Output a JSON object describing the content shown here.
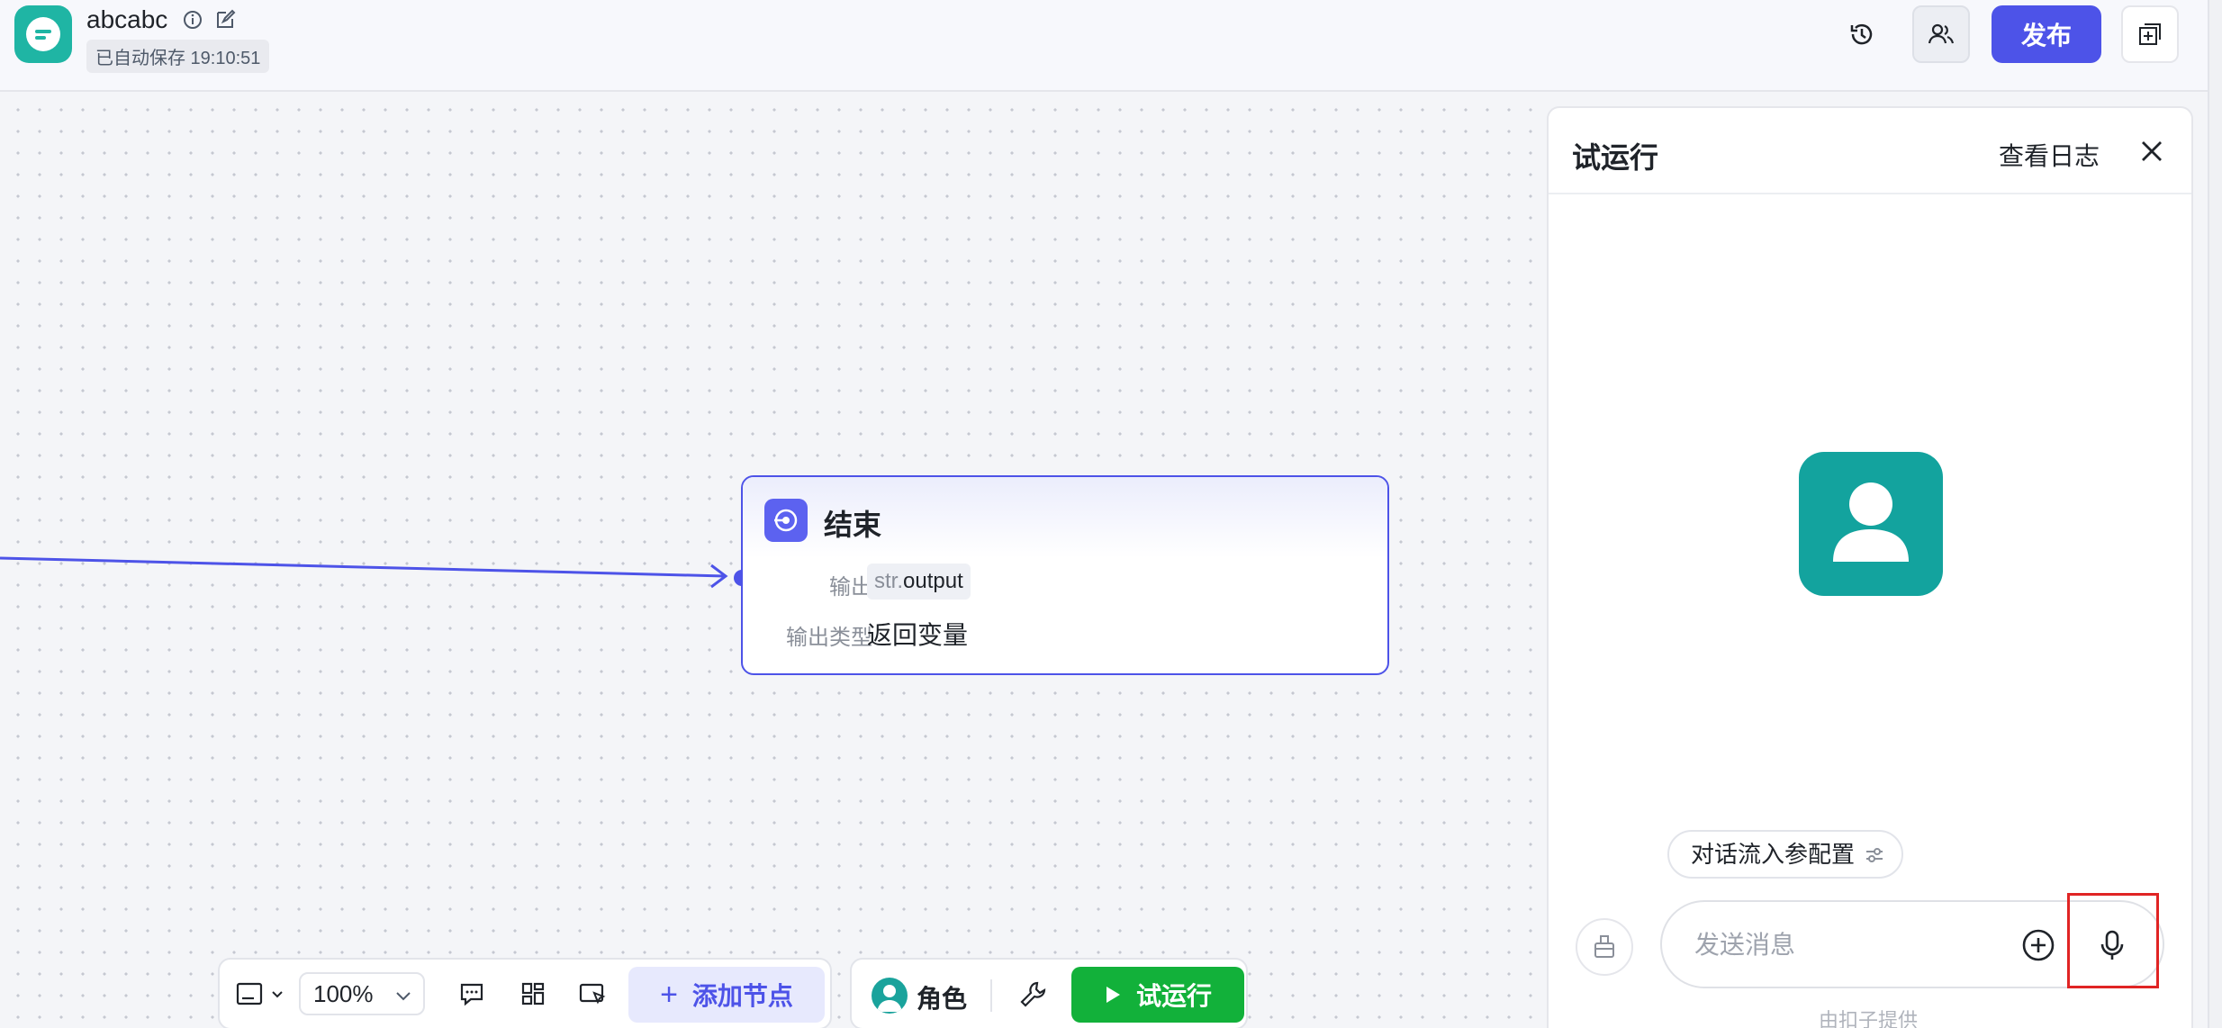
{
  "header": {
    "app_name": "abcabc",
    "autosave_text": "已自动保存 19:10:51",
    "publish_label": "发布"
  },
  "canvas": {
    "node": {
      "title": "结束",
      "output_label": "输出",
      "output_prefix": "str.",
      "output_value": "output",
      "output_type_label": "输出类型",
      "output_type_value": "返回变量"
    }
  },
  "toolbar": {
    "zoom_value": "100%",
    "add_node_label": "添加节点",
    "role_label": "角色",
    "run_label": "试运行"
  },
  "panel": {
    "title": "试运行",
    "view_log_label": "查看日志",
    "config_label": "对话流入参配置",
    "input_placeholder": "发送消息",
    "powered_by": "由扣子提供"
  },
  "colors": {
    "accent": "#4d53e8",
    "run_green": "#12b13a",
    "app_icon": "#1fb5a4",
    "bot_avatar": "#13a39e"
  }
}
